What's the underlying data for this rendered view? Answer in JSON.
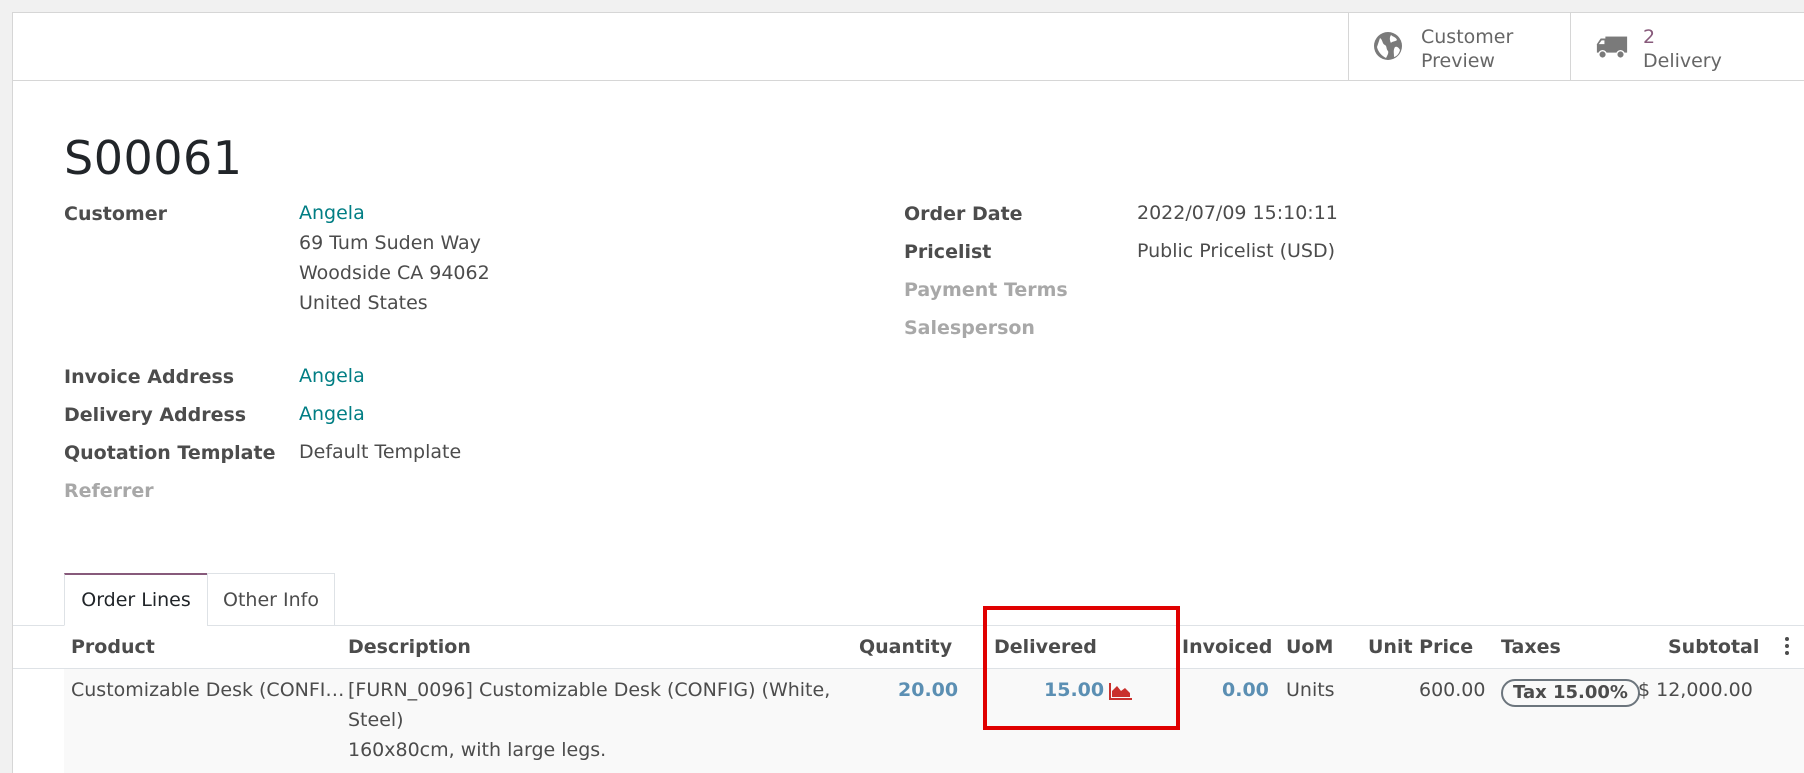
{
  "header": {
    "customer_preview": {
      "line1": "Customer",
      "line2": "Preview",
      "icon": "globe-icon"
    },
    "delivery": {
      "count": "2",
      "label": "Delivery",
      "icon": "truck-icon"
    }
  },
  "record": {
    "name": "S00061"
  },
  "left_fields": {
    "customer_label": "Customer",
    "customer_name": "Angela",
    "address_line1": "69 Tum Suden Way",
    "address_line2": "Woodside CA 94062",
    "address_line3": "United States",
    "invoice_address_label": "Invoice Address",
    "invoice_address_value": "Angela",
    "delivery_address_label": "Delivery Address",
    "delivery_address_value": "Angela",
    "quotation_template_label": "Quotation Template",
    "quotation_template_value": "Default Template",
    "referrer_label": "Referrer"
  },
  "right_fields": {
    "order_date_label": "Order Date",
    "order_date_value": "2022/07/09 15:10:11",
    "pricelist_label": "Pricelist",
    "pricelist_value": "Public Pricelist (USD)",
    "payment_terms_label": "Payment Terms",
    "salesperson_label": "Salesperson"
  },
  "tabs": [
    {
      "label": "Order Lines",
      "active": true
    },
    {
      "label": "Other Info",
      "active": false
    }
  ],
  "table": {
    "columns": [
      "Product",
      "Description",
      "Quantity",
      "Delivered",
      "Invoiced",
      "UoM",
      "Unit Price",
      "Taxes",
      "Subtotal"
    ],
    "rows": [
      {
        "product": "Customizable Desk (CONFI…",
        "description_line1": "[FURN_0096] Customizable Desk (CONFIG) (White,",
        "description_line2": "Steel)",
        "description_line3": "160x80cm, with large legs.",
        "quantity": "20.00",
        "delivered": "15.00",
        "invoiced": "0.00",
        "uom": "Units",
        "unit_price": "600.00",
        "taxes": "Tax 15.00%",
        "subtotal": "$ 12,000.00"
      }
    ]
  },
  "colors": {
    "link": "#017e84",
    "accent": "#875a7b",
    "highlight": "#e00000",
    "forecast_icon": "#c9302c"
  }
}
